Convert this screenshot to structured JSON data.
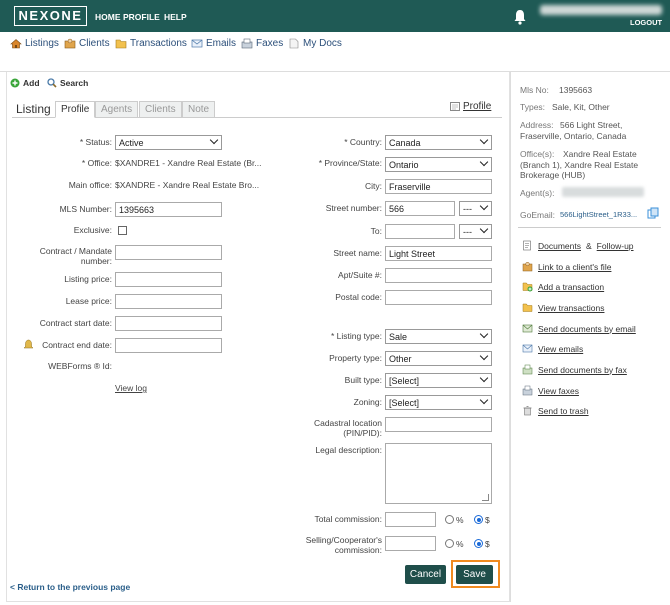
{
  "header": {
    "logo": "NEXONE",
    "nav": [
      "HOME",
      "PROFILE",
      "HELP"
    ],
    "logout": "LOGOUT"
  },
  "main_nav": [
    {
      "label": "Listings",
      "icon": "house-icon"
    },
    {
      "label": "Clients",
      "icon": "clients-icon"
    },
    {
      "label": "Transactions",
      "icon": "folder-icon"
    },
    {
      "label": "Emails",
      "icon": "envelope-icon"
    },
    {
      "label": "Faxes",
      "icon": "fax-icon"
    },
    {
      "label": "My Docs",
      "icon": "document-icon"
    }
  ],
  "toolbar": {
    "add": "Add",
    "search": "Search"
  },
  "tabs": {
    "section_label": "Listing",
    "items": [
      "Profile",
      "Agents",
      "Clients",
      "Note"
    ],
    "active": "Profile",
    "profile_link": "Profile"
  },
  "form_left": {
    "status_label": "* Status:",
    "status_value": "Active",
    "office_label": "* Office:",
    "office_value": "$XANDRE1 - Xandre Real Estate (Br...",
    "main_office_label": "Main office:",
    "main_office_value": "$XANDRE - Xandre Real Estate Bro...",
    "mls_label": "MLS Number:",
    "mls_value": "1395663",
    "exclusive_label": "Exclusive:",
    "contract_mandate_label": "Contract / Mandate number:",
    "listing_price_label": "Listing price:",
    "lease_price_label": "Lease price:",
    "contract_start_label": "Contract start date:",
    "contract_end_label": "Contract end date:",
    "webforms_label": "WEBForms ® Id:",
    "view_log": "View log"
  },
  "form_right": {
    "country_label": "* Country:",
    "country_value": "Canada",
    "province_label": "* Province/State:",
    "province_value": "Ontario",
    "city_label": "City:",
    "city_value": "Fraserville",
    "street_number_label": "Street number:",
    "street_number_value": "566",
    "street_number_suffix": "---",
    "to_label": "To:",
    "to_suffix": "---",
    "street_name_label": "Street name:",
    "street_name_value": "Light Street",
    "apt_label": "Apt/Suite #:",
    "postal_label": "Postal code:",
    "listing_type_label": "* Listing type:",
    "listing_type_value": "Sale",
    "property_type_label": "Property type:",
    "property_type_value": "Other",
    "built_type_label": "Built type:",
    "built_type_value": "[Select]",
    "zoning_label": "Zoning:",
    "zoning_value": "[Select]",
    "cadastral_label": "Cadastral location (PIN/PID):",
    "legal_label": "Legal description:",
    "total_commission_label": "Total commission:",
    "selling_commission_label": "Selling/Cooperator's commission:",
    "percent_label": "%",
    "dollar_label": "$"
  },
  "buttons": {
    "cancel": "Cancel",
    "save": "Save"
  },
  "return_link": "< Return to the previous page",
  "sidebar": {
    "mls_label": "Mls No:",
    "mls_value": "1395663",
    "types_label": "Types:",
    "types_value": "Sale, Kit, Other",
    "address_label": "Address:",
    "address_value": "566 Light Street, Fraserville, Ontario, Canada",
    "offices_label": "Office(s):",
    "offices_value": "Xandre Real Estate (Branch 1), Xandre Real Estate Brokerage (HUB)",
    "agents_label": "Agent(s):",
    "goemail_label": "GoEmail:",
    "goemail_value": "566LightStreet_1R33...",
    "actions": [
      {
        "label": "Documents",
        "extra": "Follow-up",
        "icon": "documents-icon"
      },
      {
        "label": "Link to a client's file",
        "icon": "link-client-icon"
      },
      {
        "label": "Add a transaction",
        "icon": "add-transaction-icon"
      },
      {
        "label": "View transactions",
        "icon": "folder-icon"
      },
      {
        "label": "Send documents by email",
        "icon": "email-send-icon"
      },
      {
        "label": "View emails",
        "icon": "envelope-icon"
      },
      {
        "label": "Send documents by fax",
        "icon": "fax-send-icon"
      },
      {
        "label": "View faxes",
        "icon": "fax-icon"
      },
      {
        "label": "Send to trash",
        "icon": "trash-icon"
      }
    ]
  },
  "colors": {
    "header_bg": "#1f5a55",
    "button_bg": "#1f4e4a",
    "highlight": "#f08a1f",
    "link": "#2b5f8a"
  }
}
